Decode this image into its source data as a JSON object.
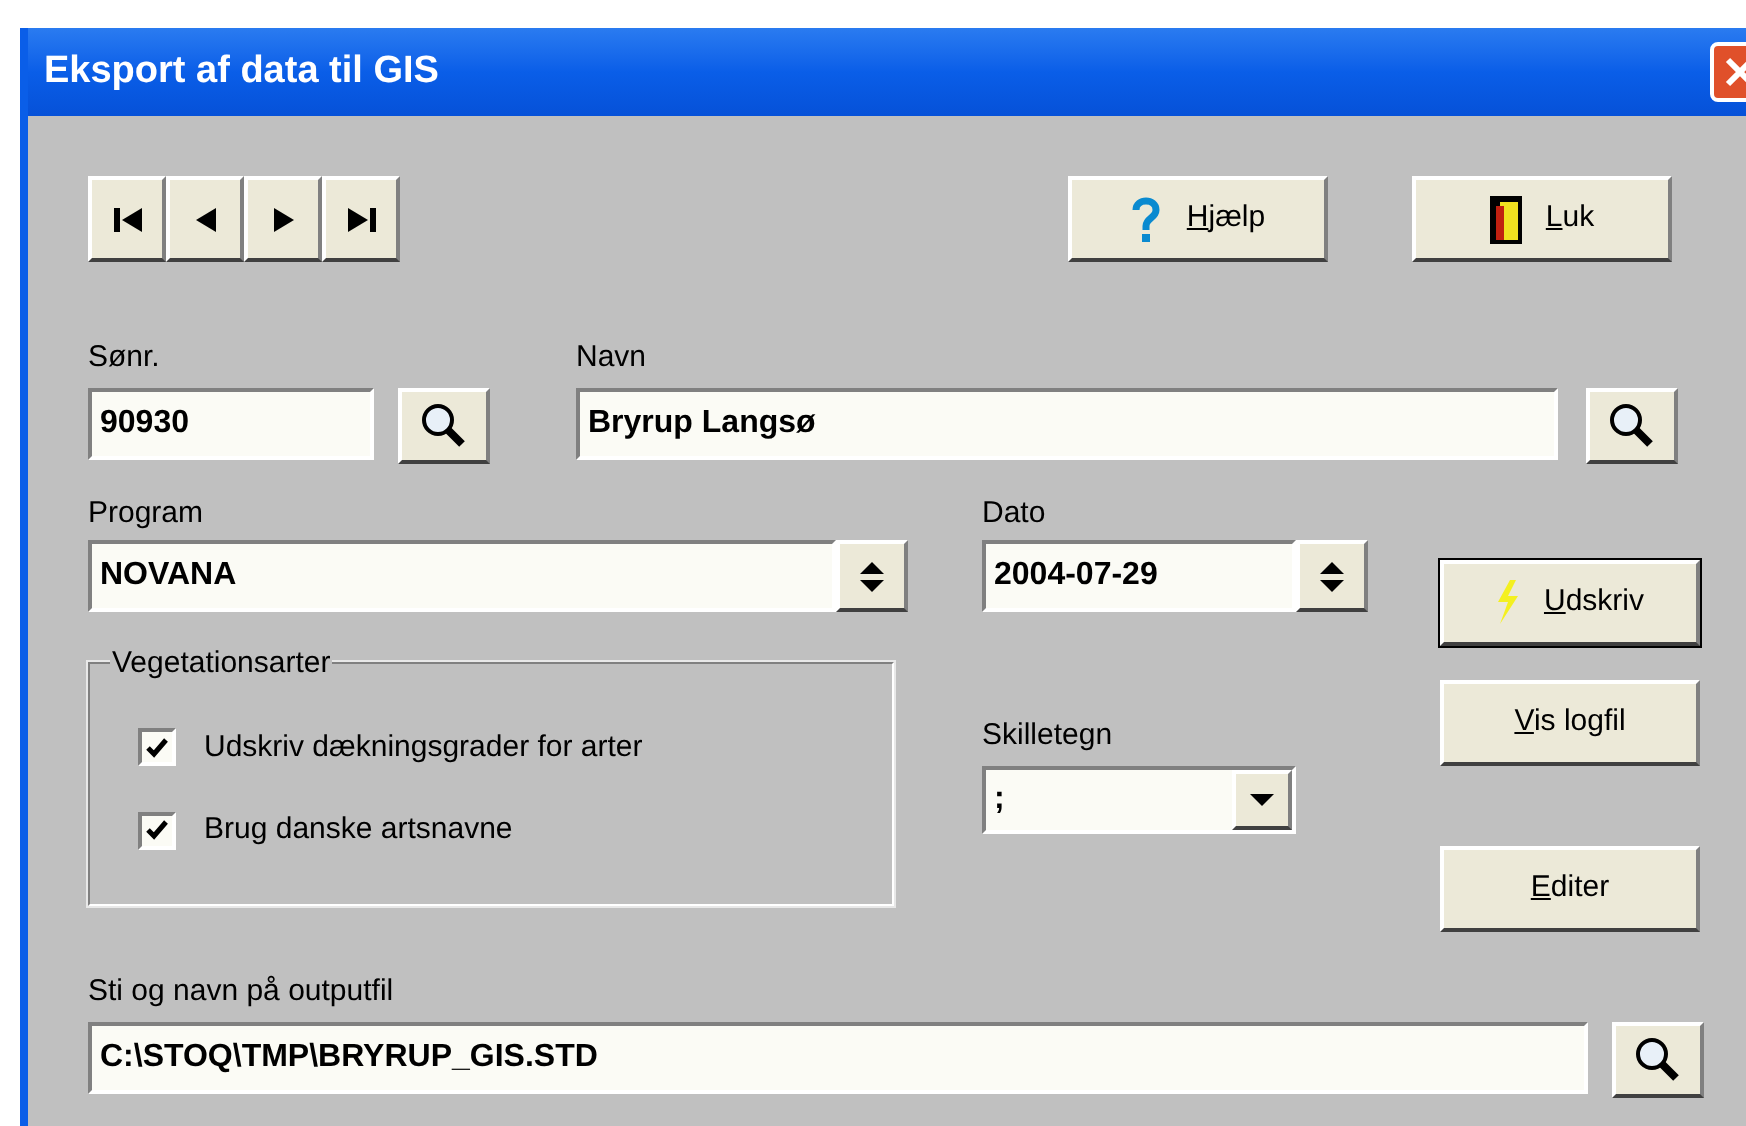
{
  "window": {
    "title": "Eksport af data til GIS"
  },
  "nav_buttons": [
    {
      "kind": "first"
    },
    {
      "kind": "prev"
    },
    {
      "kind": "next"
    },
    {
      "kind": "last"
    }
  ],
  "help_button": {
    "label": "Hjælp"
  },
  "close_button": {
    "label": "Luk"
  },
  "station": {
    "label": "Sønr.",
    "value": "90930"
  },
  "name": {
    "label": "Navn",
    "value": "Bryrup Langsø"
  },
  "program": {
    "label": "Program",
    "value": "NOVANA"
  },
  "date": {
    "label": "Dato",
    "value": "2004-07-29"
  },
  "print_button": {
    "label": "Udskriv"
  },
  "vegetation": {
    "title": "Vegetationsarter",
    "options": [
      {
        "label": "Udskriv dækningsgrader for arter",
        "checked": true
      },
      {
        "label": "Brug danske artsnavne",
        "checked": true
      }
    ]
  },
  "separator": {
    "label": "Skilletegn",
    "value": ";"
  },
  "log_button": {
    "label": "Vis logfil"
  },
  "edit_button": {
    "label": "Editer"
  },
  "output": {
    "label": "Sti og navn på outputfil",
    "value": "C:\\STOQ\\TMP\\BRYRUP_GIS.STD"
  }
}
